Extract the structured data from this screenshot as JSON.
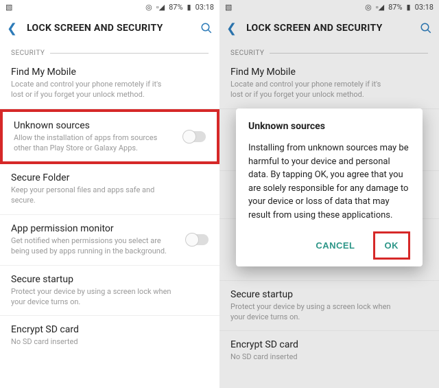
{
  "status": {
    "battery_pct": "87%",
    "time": "03:18"
  },
  "appbar": {
    "title": "LOCK SCREEN AND SECURITY"
  },
  "section": {
    "header": "SECURITY"
  },
  "items": {
    "find": {
      "title": "Find My Mobile",
      "desc": "Locate and control your phone remotely if it's lost or if you forget your unlock method."
    },
    "unknown": {
      "title": "Unknown sources",
      "desc": "Allow the installation of apps from sources other than Play Store or Galaxy Apps."
    },
    "secure_folder": {
      "title": "Secure Folder",
      "desc": "Keep your personal files and apps safe and secure."
    },
    "perm_monitor": {
      "title": "App permission monitor",
      "desc": "Get notified when permissions you select are being used by apps running in the background."
    },
    "secure_startup": {
      "title": "Secure startup",
      "desc": "Protect your device by using a screen lock when your device turns on."
    },
    "encrypt_sd": {
      "title": "Encrypt SD card",
      "desc": "No SD card inserted"
    }
  },
  "dialog": {
    "title": "Unknown sources",
    "body": "Installing from unknown sources may be harmful to your device and personal data. By tapping OK, you agree that you are solely responsible for any damage to your device or loss of data that may result from using these applications.",
    "cancel": "CANCEL",
    "ok": "OK"
  }
}
